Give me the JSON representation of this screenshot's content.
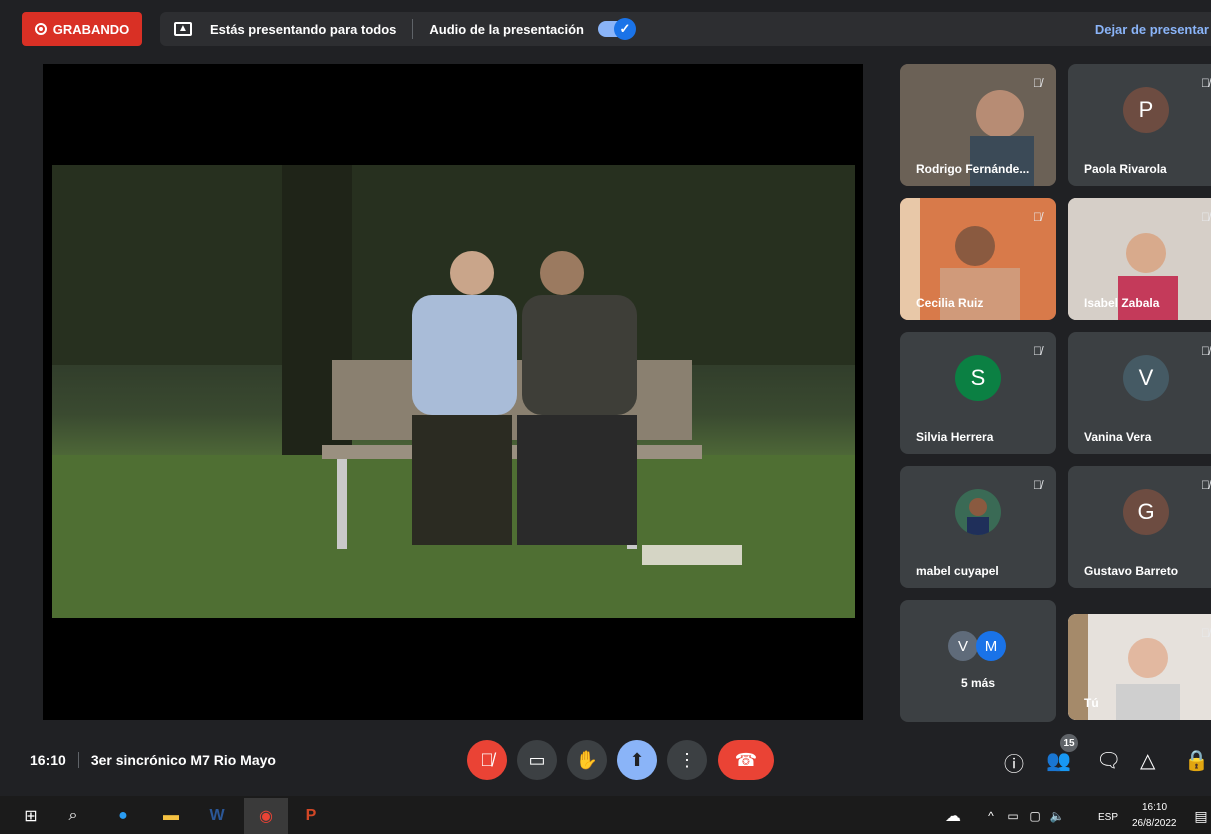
{
  "top_bar": {
    "recording_label": "GRABANDO",
    "presenting_text": "Estás presentando para todos",
    "audio_label": "Audio de la presentación",
    "audio_toggle_on": true,
    "stop_presenting_label": "Dejar de presentar"
  },
  "participants": [
    {
      "name": "Rodrigo Fernánde...",
      "type": "video",
      "muted": true
    },
    {
      "name": "Paola Rivarola",
      "initial": "P",
      "avatar_color": "#6d4c41",
      "muted": true
    },
    {
      "name": "Cecilia Ruiz",
      "type": "video",
      "muted": true
    },
    {
      "name": "Isabel Zabala",
      "type": "video",
      "muted": true
    },
    {
      "name": "Silvia Herrera",
      "initial": "S",
      "avatar_color": "#0b8043",
      "muted": true
    },
    {
      "name": "Vanina Vera",
      "initial": "V",
      "avatar_color": "#455a64",
      "muted": true
    },
    {
      "name": "mabel cuyapel",
      "type": "photo",
      "muted": true
    },
    {
      "name": "Gustavo Barreto",
      "initial": "G",
      "avatar_color": "#6d4c41",
      "muted": true
    },
    {
      "name": "Tú",
      "type": "video",
      "muted": true
    }
  ],
  "more_tile": {
    "initials": [
      "V",
      "M"
    ],
    "colors": [
      "#5f6b7a",
      "#1a73e8"
    ],
    "label": "5 más"
  },
  "meeting": {
    "time": "16:10",
    "title": "3er sincrónico M7 Rio Mayo"
  },
  "controls": {
    "mic": {
      "icon": "mic-off-icon",
      "color": "#ea4335"
    },
    "camera": {
      "icon": "camera-icon"
    },
    "hand": {
      "icon": "raise-hand-icon"
    },
    "present": {
      "icon": "present-screen-icon",
      "color": "#8ab4f8"
    },
    "more": {
      "icon": "more-vert-icon"
    },
    "hangup": {
      "icon": "hang-up-icon",
      "color": "#ea4335"
    }
  },
  "side_controls": {
    "participants_count": "15"
  },
  "taskbar": {
    "language": "ESP",
    "time": "16:10",
    "date": "26/8/2022"
  }
}
